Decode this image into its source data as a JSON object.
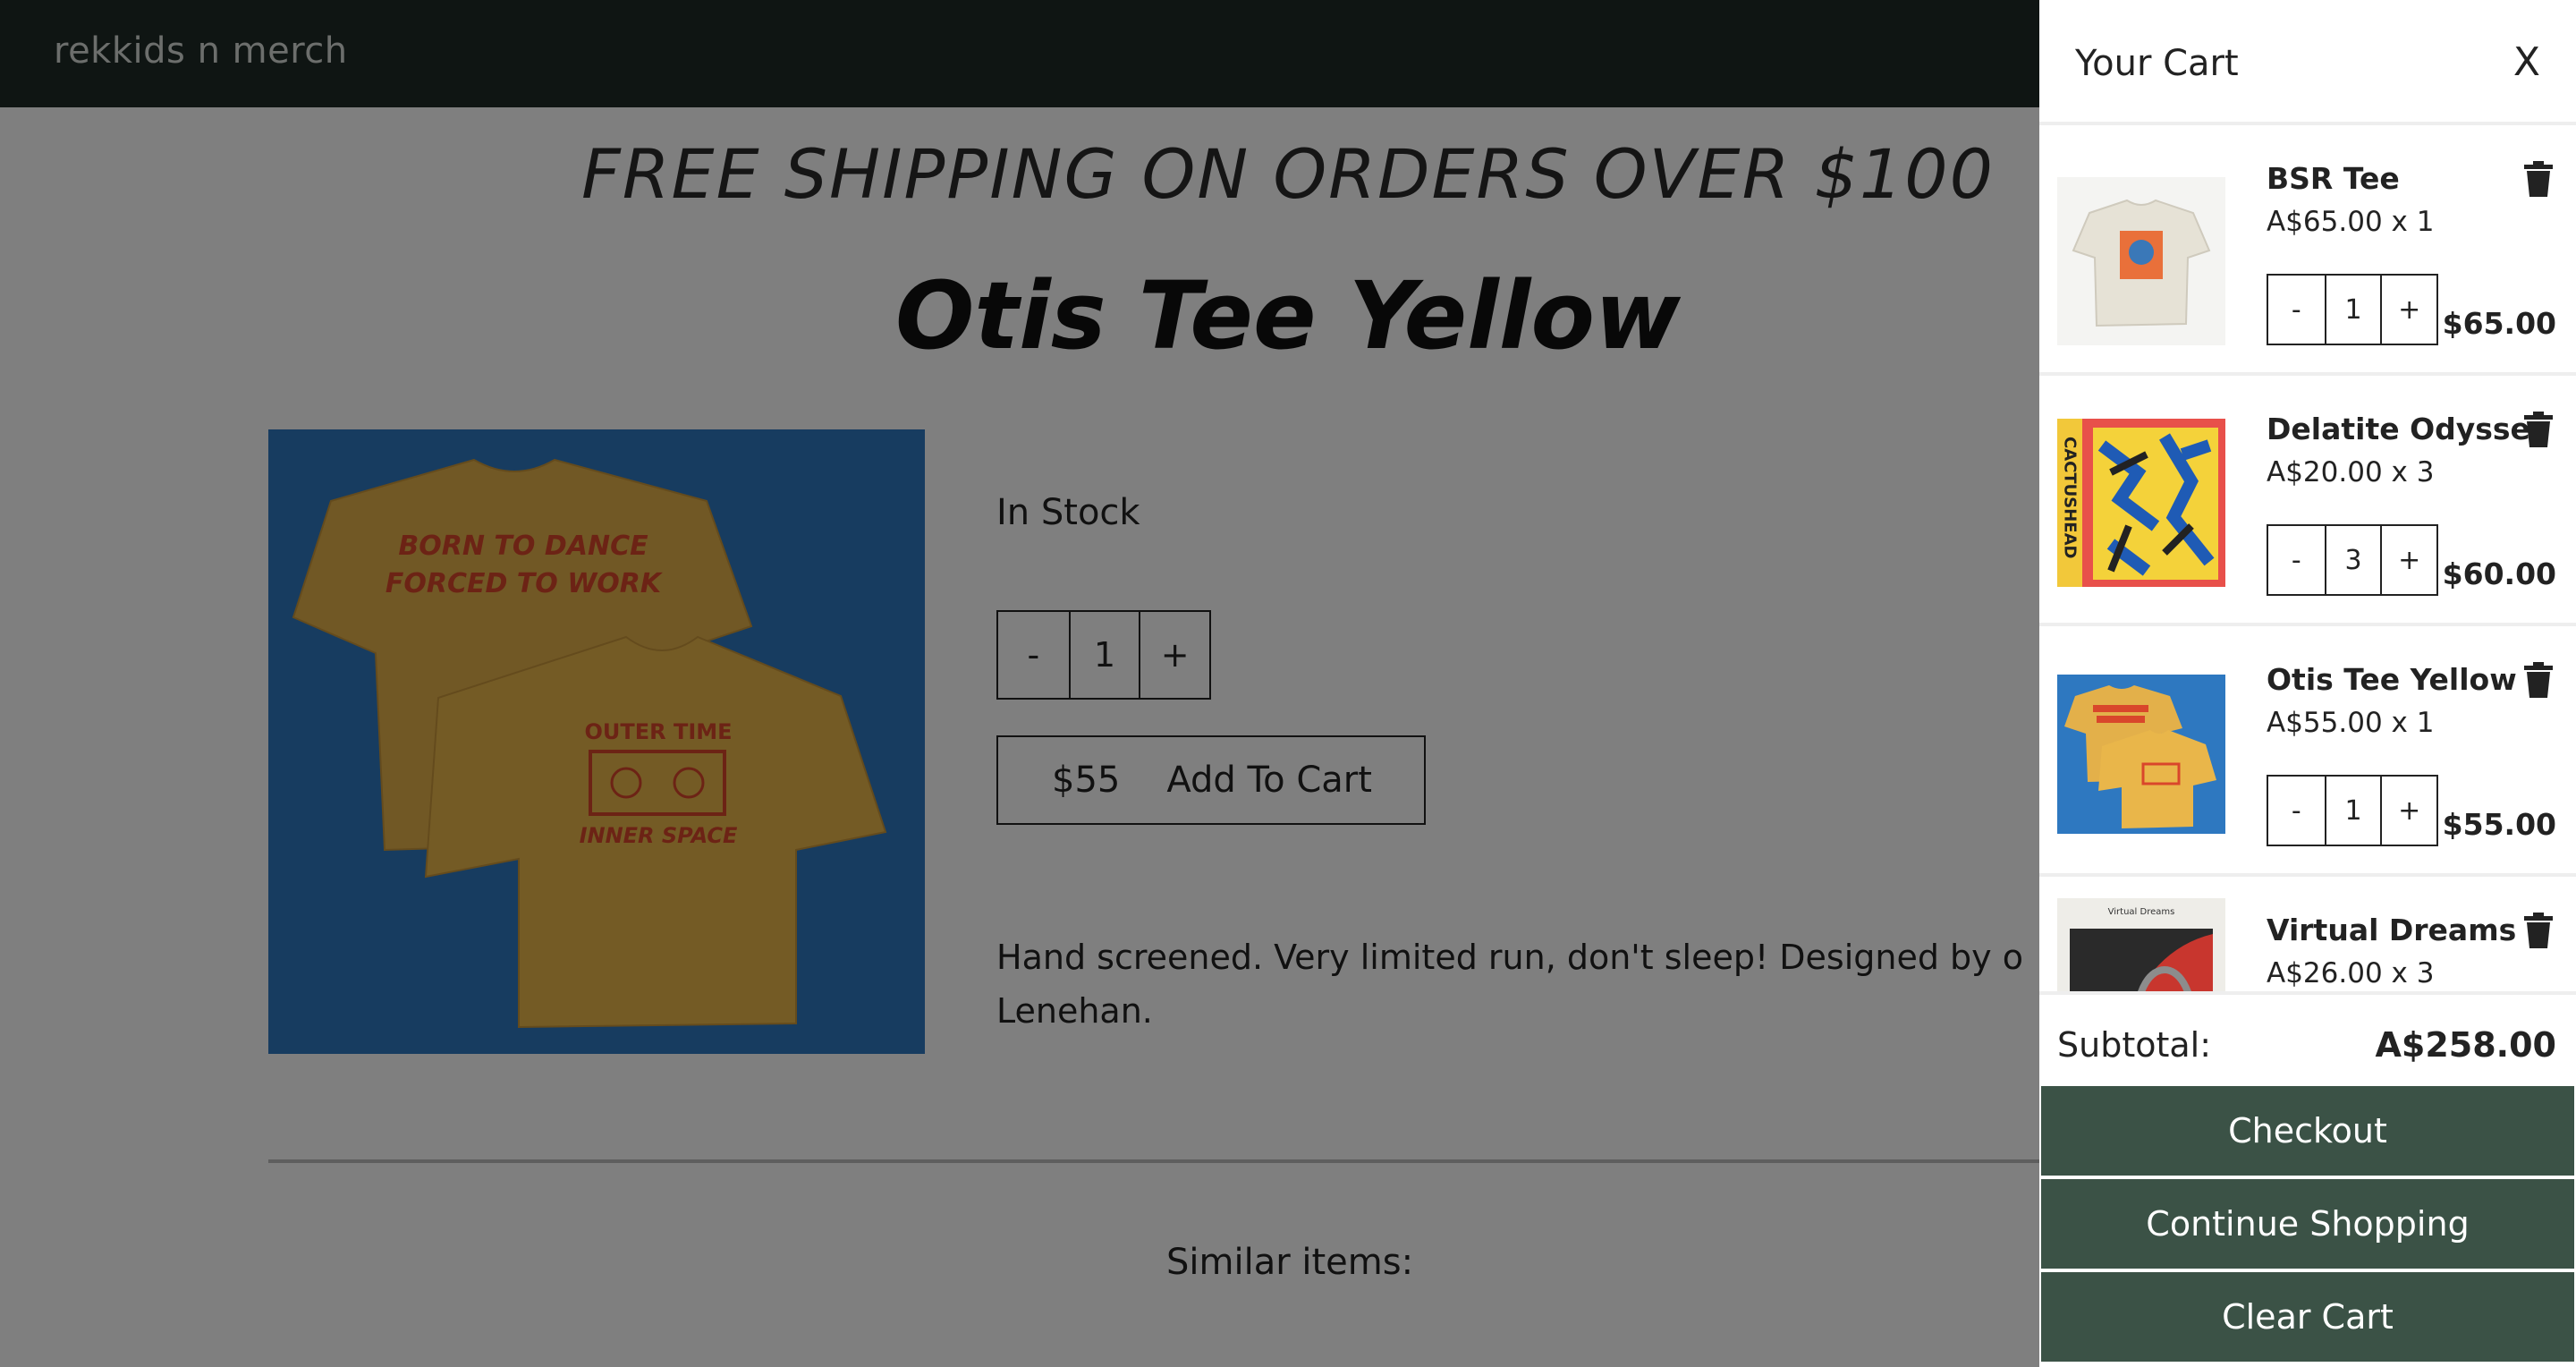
{
  "header": {
    "brand": "rekkids n merch"
  },
  "promo": "FREE SHIPPING ON ORDERS OVER $100",
  "product": {
    "title": "Otis Tee Yellow",
    "stock": "In Stock",
    "quantity": "1",
    "minus": "-",
    "plus": "+",
    "price": "$55",
    "add_label": "Add To Cart",
    "description": "Hand screened. Very limited run, don't sleep! Designed by o Lenehan.",
    "image_text": {
      "back": [
        "BORN TO DANCE",
        "FORCED TO WORK"
      ],
      "front": [
        "OUTER TIME",
        "INNER SPACE"
      ]
    }
  },
  "similar_label": "Similar items:",
  "cart": {
    "title": "Your Cart",
    "close": "X",
    "items": [
      {
        "name": "BSR Tee",
        "unit": "A$65.00 x 1",
        "qty": "1",
        "total": "$65.00"
      },
      {
        "name": "Delatite Odyssey",
        "unit": "A$20.00 x 3",
        "qty": "3",
        "total": "$60.00",
        "cover_text": "CACTUSHEAD"
      },
      {
        "name": "Otis Tee Yellow",
        "unit": "A$55.00 x 1",
        "qty": "1",
        "total": "$55.00"
      },
      {
        "name": "Virtual Dreams",
        "unit": "A$26.00 x 3",
        "qty": "3",
        "total": "",
        "cover_text": "Virtual Dreams"
      }
    ],
    "minus": "-",
    "plus": "+",
    "subtotal_label": "Subtotal:",
    "subtotal_value": "A$258.00",
    "checkout": "Checkout",
    "continue": "Continue Shopping",
    "clear": "Clear Cart"
  },
  "colors": {
    "header_bg": "#1e2a26",
    "button_bg": "#3b5246",
    "overlay": "rgba(0,0,0,0.5)",
    "shirt_yellow": "#e9b64a",
    "print_red": "#d9462b",
    "image_blue": "#2e78c0"
  },
  "icons": {
    "trash": "trash-icon",
    "close": "close-icon"
  }
}
